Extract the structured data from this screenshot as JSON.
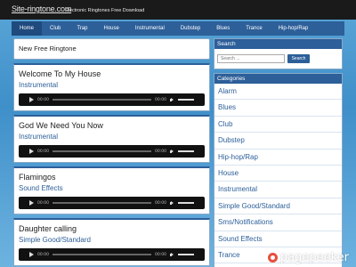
{
  "header": {
    "logo": "Site-ringtone.com",
    "tagline": "Electronic Ringtones Free Download"
  },
  "nav": {
    "items": [
      "Home",
      "Club",
      "Trap",
      "House",
      "Instrumental",
      "Dubstep",
      "Blues",
      "Trance",
      "Hip-hop/Rap"
    ]
  },
  "main": {
    "heading": "New Free Ringtone",
    "songs": [
      {
        "title": "Welcome To My House",
        "category": "Instrumental",
        "time_current": "00:00",
        "time_total": "00:00"
      },
      {
        "title": "God We Need You Now",
        "category": "Instrumental",
        "time_current": "00:00",
        "time_total": "00:00"
      },
      {
        "title": "Flamingos",
        "category": "Sound Effects",
        "time_current": "00:00",
        "time_total": "00:00"
      },
      {
        "title": "Daughter calling",
        "category": "Simple Good/Standard",
        "time_current": "00:00",
        "time_total": "00:00"
      }
    ]
  },
  "sidebar": {
    "search_title": "Search",
    "search_placeholder": "Search ...",
    "search_button": "Search",
    "categories_title": "Categories",
    "categories": [
      "Alarm",
      "Blues",
      "Club",
      "Dubstep",
      "Hip-hop/Rap",
      "House",
      "Instrumental",
      "Simple Good/Standard",
      "Sms/Notifications",
      "Sound Effects",
      "Trance"
    ]
  },
  "watermark": "pagepeeker",
  "colors": {
    "accent": "#2d5f99",
    "header_bg": "#1a1a1a",
    "background": "#4a98d0"
  }
}
